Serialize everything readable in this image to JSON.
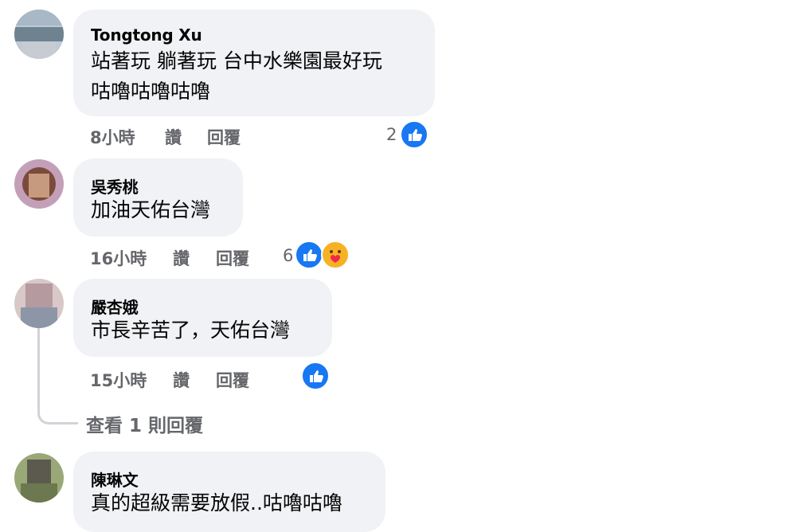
{
  "comments": [
    {
      "author": "Tongtong Xu",
      "lines": [
        "站著玩 躺著玩 台中水樂園最好玩",
        "咕嚕咕嚕咕嚕"
      ],
      "time": "8小時",
      "read": "讚",
      "reply": "回覆",
      "reaction_count": "2",
      "reactions": [
        "like-icon"
      ]
    },
    {
      "author": "吳秀桃",
      "lines": [
        "加油天佑台灣"
      ],
      "time": "16小時",
      "read": "讚",
      "reply": "回覆",
      "reaction_count": "6",
      "reactions": [
        "like-icon",
        "care-icon"
      ]
    },
    {
      "author": "嚴杏娥",
      "lines": [
        "市長辛苦了，天佑台灣"
      ],
      "time": "15小時",
      "read": "讚",
      "reply": "回覆",
      "reaction_count": "",
      "reactions": [
        "like-icon"
      ],
      "view_replies": "查看 1 則回覆"
    },
    {
      "author": "陳琳文",
      "lines": [
        "真的超級需要放假..咕嚕咕嚕"
      ]
    }
  ],
  "colors": {
    "bubble": "#f0f2f5",
    "meta": "#65676b",
    "like": "#1877f2"
  }
}
